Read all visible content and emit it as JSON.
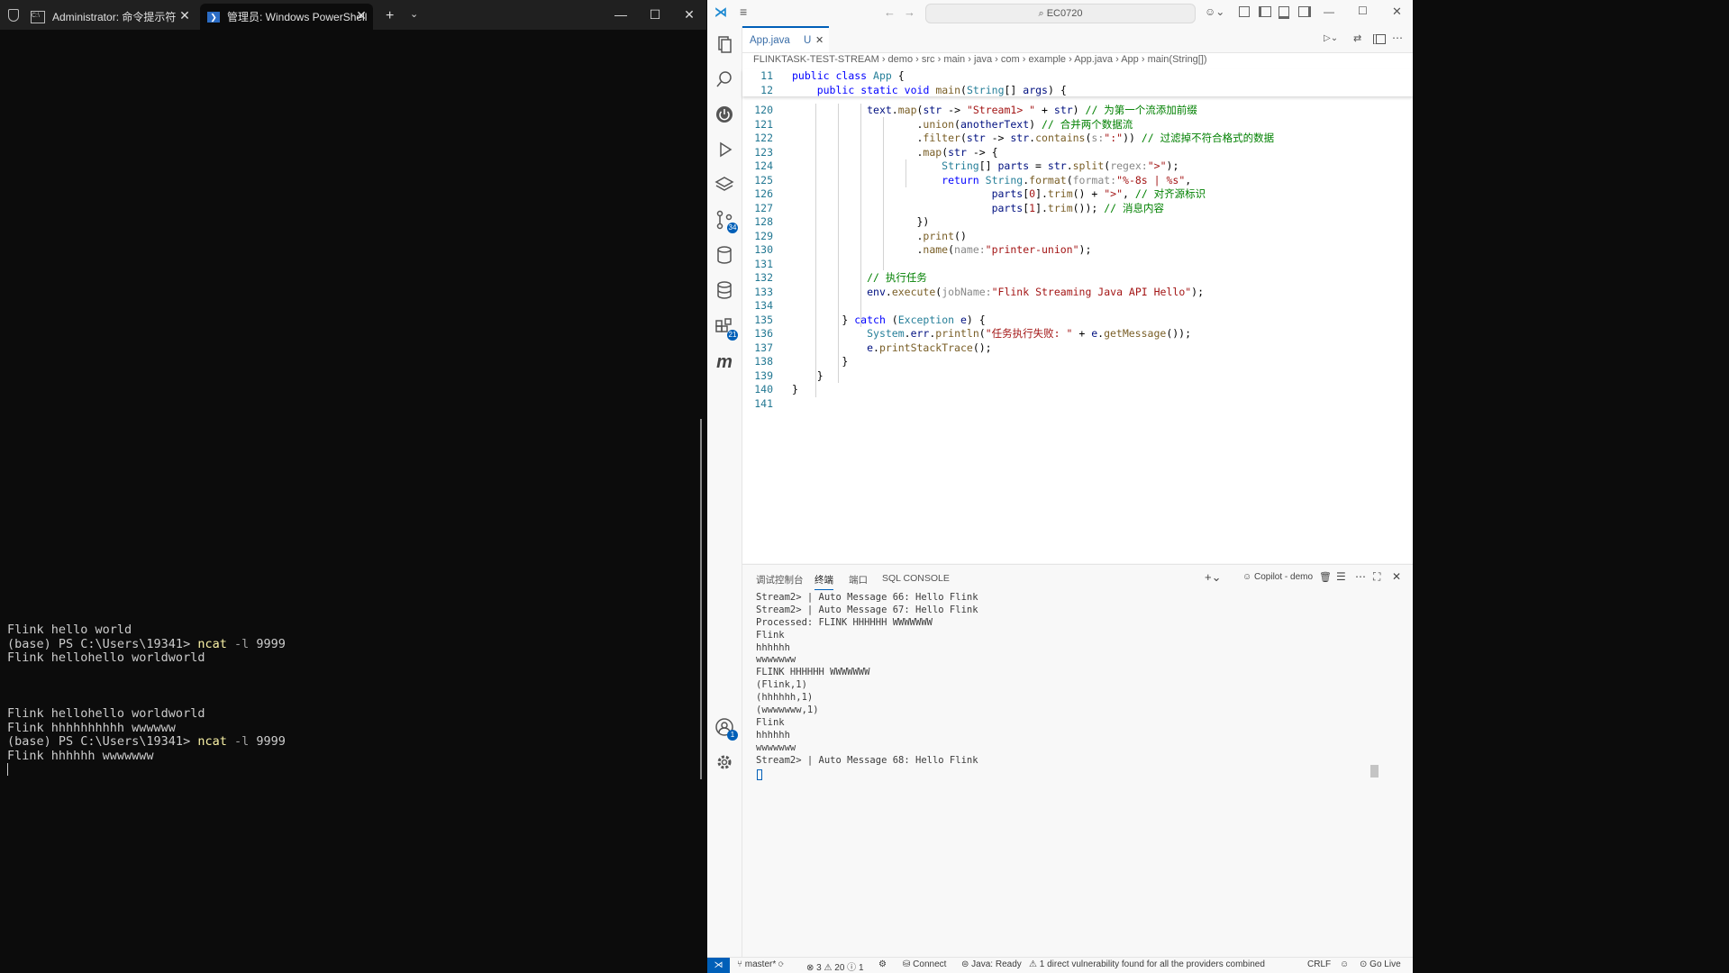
{
  "terminal": {
    "tabs": [
      {
        "title": "Administrator: 命令提示符",
        "active": false
      },
      {
        "title": "管理员: Windows PowerShell",
        "active": true
      }
    ],
    "lines": [
      {
        "segments": [
          {
            "t": "Flink hello world",
            "c": ""
          }
        ]
      },
      {
        "segments": [
          {
            "t": "(base) PS C:\\Users\\19341> ",
            "c": ""
          },
          {
            "t": "ncat",
            "c": "cmd"
          },
          {
            "t": " -l ",
            "c": "flag"
          },
          {
            "t": "9999",
            "c": ""
          }
        ]
      },
      {
        "segments": [
          {
            "t": "Flink hellohello worldworld",
            "c": ""
          }
        ]
      },
      {
        "segments": [
          {
            "t": "",
            "c": ""
          }
        ]
      },
      {
        "segments": [
          {
            "t": "",
            "c": ""
          }
        ]
      },
      {
        "segments": [
          {
            "t": "",
            "c": ""
          }
        ]
      },
      {
        "segments": [
          {
            "t": "Flink hellohello worldworld",
            "c": ""
          }
        ]
      },
      {
        "segments": [
          {
            "t": "Flink hhhhhhhhhh wwwwww",
            "c": ""
          }
        ]
      },
      {
        "segments": [
          {
            "t": "(base) PS C:\\Users\\19341> ",
            "c": ""
          },
          {
            "t": "ncat",
            "c": "cmd"
          },
          {
            "t": " -l ",
            "c": "flag"
          },
          {
            "t": "9999",
            "c": ""
          }
        ]
      },
      {
        "segments": [
          {
            "t": "Flink hhhhhh wwwwwww",
            "c": ""
          }
        ]
      }
    ]
  },
  "vscode": {
    "search": "EC0720",
    "tab": {
      "label": "App.java",
      "status": "U"
    },
    "breadcrumb": [
      "FLINKTASK-TEST-STREAM",
      "demo",
      "src",
      "main",
      "java",
      "com",
      "example",
      "App.java",
      "App",
      "main(String[])"
    ],
    "sticky": [
      {
        "ln": "11",
        "html": "<span class='kw'>public</span> <span class='kw'>class</span> <span class='ty'>App</span> {"
      },
      {
        "ln": "12",
        "html": "    <span class='kw'>public</span> <span class='kw'>static</span> <span class='kw'>void</span> <span class='fn'>main</span>(<span class='ty'>String</span>[] <span class='vr'>args</span>) {"
      }
    ],
    "code": [
      {
        "ln": "120",
        "html": "            <span class='vr'>text</span>.<span class='fn'>map</span>(<span class='vr'>str</span> -> <span class='st'>\"Stream1> \"</span> + <span class='vr'>str</span>) <span class='cm'>// 为第一个流添加前缀</span>"
      },
      {
        "ln": "121",
        "html": "                    .<span class='fn'>union</span>(<span class='vr'>anotherText</span>) <span class='cm'>// 合并两个数据流</span>"
      },
      {
        "ln": "122",
        "html": "                    .<span class='fn'>filter</span>(<span class='vr'>str</span> -> <span class='vr'>str</span>.<span class='fn'>contains</span>(<span class='hint'>s:</span><span class='st'>\":\"</span>)) <span class='cm'>// 过滤掉不符合格式的数据</span>"
      },
      {
        "ln": "123",
        "html": "                    .<span class='fn'>map</span>(<span class='vr'>str</span> -> {"
      },
      {
        "ln": "124",
        "html": "                        <span class='ty'>String</span>[] <span class='vr'>parts</span> = <span class='vr'>str</span>.<span class='fn'>split</span>(<span class='hint'>regex:</span><span class='st'>\">\"</span>);"
      },
      {
        "ln": "125",
        "html": "                        <span class='kw'>return</span> <span class='ty'>String</span>.<span class='fn'>format</span>(<span class='hint'>format:</span><span class='st'>\"%-8s | %s\"</span>,"
      },
      {
        "ln": "126",
        "html": "                                <span class='vr'>parts</span>[<span class='st'>0</span>].<span class='fn'>trim</span>() + <span class='st'>\">\"</span>, <span class='cm'>// 对齐源标识</span>"
      },
      {
        "ln": "127",
        "html": "                                <span class='vr'>parts</span>[<span class='st'>1</span>].<span class='fn'>trim</span>()); <span class='cm'>// 消息内容</span>"
      },
      {
        "ln": "128",
        "html": "                    })"
      },
      {
        "ln": "129",
        "html": "                    .<span class='fn'>print</span>()"
      },
      {
        "ln": "130",
        "html": "                    .<span class='fn'>name</span>(<span class='hint'>name:</span><span class='st'>\"printer-union\"</span>);"
      },
      {
        "ln": "131",
        "html": ""
      },
      {
        "ln": "132",
        "html": "            <span class='cm'>// 执行任务</span>"
      },
      {
        "ln": "133",
        "html": "            <span class='vr'>env</span>.<span class='fn'>execute</span>(<span class='hint'>jobName:</span><span class='st'>\"Flink Streaming Java API Hello\"</span>);"
      },
      {
        "ln": "134",
        "html": ""
      },
      {
        "ln": "135",
        "html": "        } <span class='kw'>catch</span> (<span class='ty'>Exception</span> <span class='vr'>e</span>) {"
      },
      {
        "ln": "136",
        "html": "            <span class='ty'>System</span>.<span class='vr'>err</span>.<span class='fn'>println</span>(<span class='st'>\"任务执行失败: \"</span> + <span class='vr'>e</span>.<span class='fn'>getMessage</span>());"
      },
      {
        "ln": "137",
        "html": "            <span class='vr'>e</span>.<span class='fn'>printStackTrace</span>();"
      },
      {
        "ln": "138",
        "html": "        }"
      },
      {
        "ln": "139",
        "html": "    }"
      },
      {
        "ln": "140",
        "html": "}"
      },
      {
        "ln": "141",
        "html": ""
      }
    ],
    "panel_tabs": [
      "调试控制台",
      "终端",
      "端口",
      "SQL CONSOLE"
    ],
    "panel_active": "终端",
    "copilot_label": "Copilot - demo",
    "output": [
      "Stream2> | Auto Message 66: Hello Flink",
      "Stream2> | Auto Message 67: Hello Flink",
      "Processed: FLINK HHHHHH WWWWWWW",
      "Flink",
      "hhhhhh",
      "wwwwwww",
      "FLINK HHHHHH WWWWWWW",
      "(Flink,1)",
      "(hhhhhh,1)",
      "(wwwwwww,1)",
      "Flink",
      "hhhhhh",
      "wwwwwww",
      "Stream2> | Auto Message 68: Hello Flink"
    ],
    "status": {
      "branch": "master*",
      "errors": "3",
      "warnings": "20",
      "info": "1",
      "connect": "Connect",
      "java": "Java: Ready",
      "vuln": "1 direct vulnerability found for all the providers combined",
      "eol": "CRLF",
      "golive": "Go Live"
    },
    "badges": {
      "scm": "34",
      "ext": "21",
      "account": "1"
    }
  }
}
